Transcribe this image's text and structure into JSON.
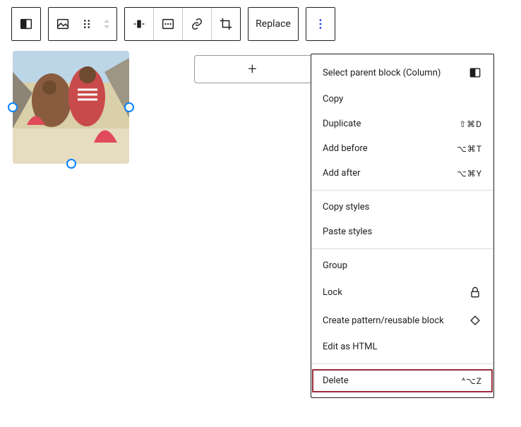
{
  "toolbar": {
    "replace_label": "Replace"
  },
  "add_block": {
    "plus": "+"
  },
  "menu": {
    "select_parent": "Select parent block (Column)",
    "copy": "Copy",
    "duplicate": "Duplicate",
    "duplicate_shortcut": "⇧⌘D",
    "add_before": "Add before",
    "add_before_shortcut": "⌥⌘T",
    "add_after": "Add after",
    "add_after_shortcut": "⌥⌘Y",
    "copy_styles": "Copy styles",
    "paste_styles": "Paste styles",
    "group": "Group",
    "lock": "Lock",
    "create_pattern": "Create pattern/reusable block",
    "edit_html": "Edit as HTML",
    "delete": "Delete",
    "delete_shortcut": "^⌥Z"
  }
}
